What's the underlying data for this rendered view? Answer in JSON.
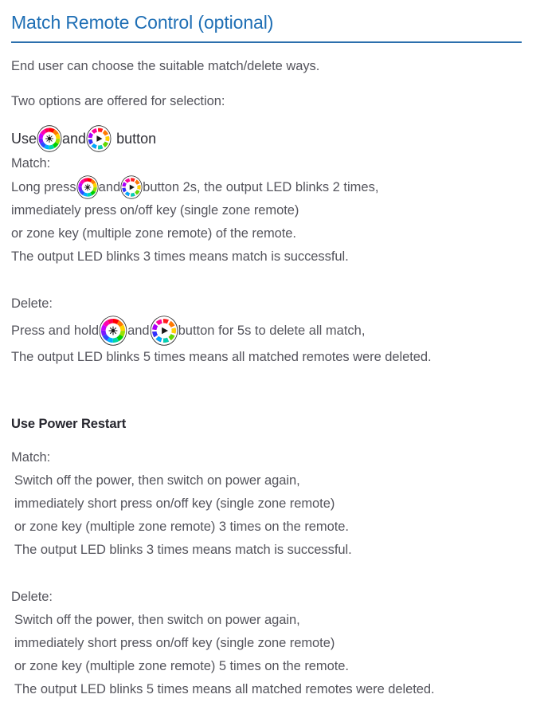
{
  "heading": {
    "title": "Match Remote Control (optional)",
    "rule_color": "#2b6fad",
    "text_color": "#1f6fb5"
  },
  "intro": {
    "line1": "End user can choose the suitable match/delete ways.",
    "line2": "Two options are offered for selection:"
  },
  "icons": {
    "brightness": {
      "name": "rainbow-ring-brightness-icon",
      "glyph": "sun-asterisk",
      "ring_type": "continuous-rainbow-gradient",
      "center_color": "#1a1a1a"
    },
    "mode": {
      "name": "rainbow-ring-mode-icon",
      "glyph": "play-triangle",
      "ring_type": "segmented-rainbow",
      "center_color": "#1a1a1a",
      "segment_colors": [
        "#ff1e1e",
        "#ff7a00",
        "#ffd400",
        "#6ee000",
        "#00d4a0",
        "#00b6ff",
        "#4040ff",
        "#b000ff",
        "#ff00a0"
      ]
    }
  },
  "section_buttons": {
    "use_line": {
      "pre": "Use",
      "mid": "and",
      "post": "button"
    },
    "match": {
      "label": "Match:",
      "line1_pre": "Long press",
      "line1_mid": "and",
      "line1_post": "button 2s, the output LED blinks 2 times,",
      "line2": "immediately press on/off key (single zone remote)",
      "line3": "or zone key (multiple zone remote) of the remote.",
      "line4": "The output LED blinks 3 times means match is successful."
    },
    "delete": {
      "label": "Delete:",
      "line1_pre": "Press and hold",
      "line1_mid": "and",
      "line1_post": "button for 5s to delete all match,",
      "line2": "The output LED blinks 5 times means all matched remotes were deleted."
    }
  },
  "section_power_restart": {
    "heading": "Use Power Restart",
    "match": {
      "label": "Match:",
      "line1": "Switch off the power, then switch on power again,",
      "line2": "immediately short press on/off key (single zone remote)",
      "line3": "or zone key (multiple zone remote) 3 times on the remote.",
      "line4": "The output LED blinks 3 times means match is successful."
    },
    "delete": {
      "label": "Delete:",
      "line1": "Switch off the power, then switch on power again,",
      "line2": "immediately short press on/off key (single zone remote)",
      "line3": "or zone key (multiple zone remote) 5 times on the remote.",
      "line4": "The output LED blinks 5 times means all matched remotes were deleted."
    }
  }
}
